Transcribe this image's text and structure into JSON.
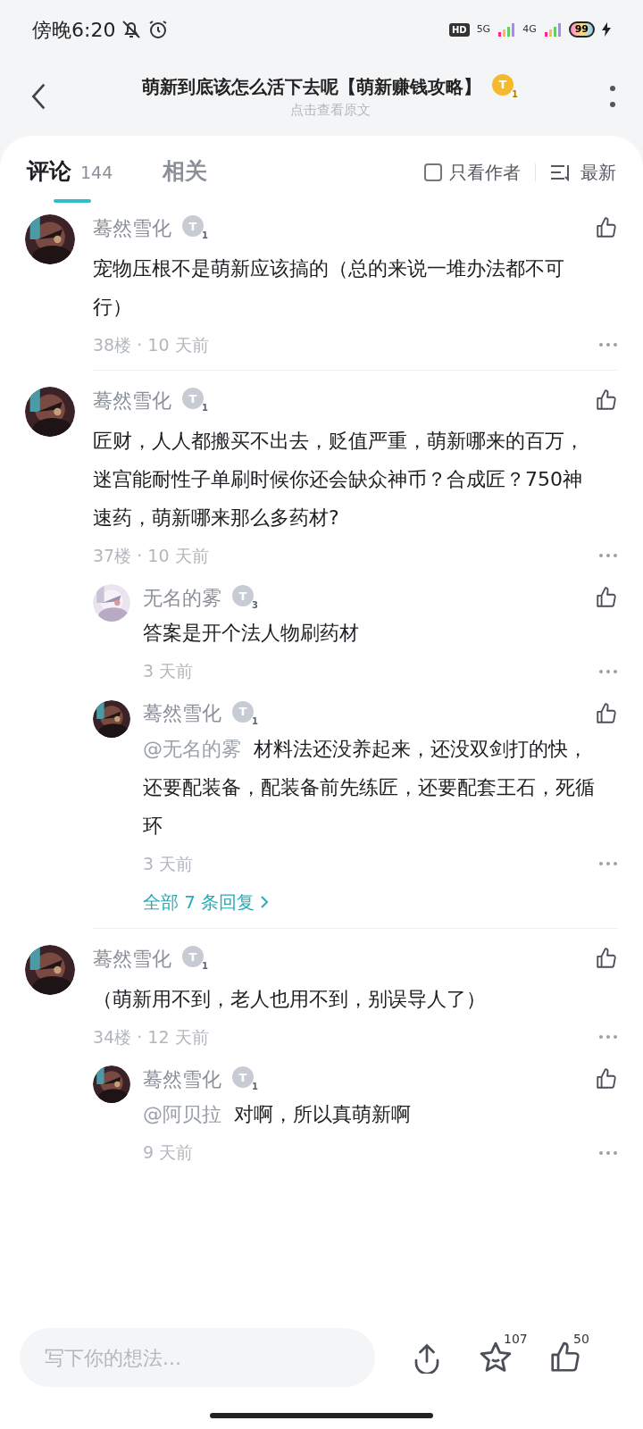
{
  "status_bar": {
    "time": "傍晚6:20",
    "hd": "HD",
    "net1": "5G",
    "net2": "4G",
    "battery": "99"
  },
  "header": {
    "title": "萌新到底该怎么活下去呢【萌新赚钱攻略】",
    "badge": {
      "letter": "T",
      "sub": "1"
    },
    "subtitle": "点击查看原文"
  },
  "tabs": [
    {
      "label": "评论",
      "count": "144",
      "selected": true
    },
    {
      "label": "相关",
      "selected": false
    }
  ],
  "author_only": {
    "label": "只看作者",
    "checked": false
  },
  "sort": {
    "label": "最新"
  },
  "comments": [
    {
      "name": "蓦然雪化",
      "badge": {
        "letter": "T",
        "sub": "1"
      },
      "text": "宠物压根不是萌新应该搞的（总的来说一堆办法都不可行）",
      "meta": "38楼 · 10 天前"
    },
    {
      "name": "蓦然雪化",
      "badge": {
        "letter": "T",
        "sub": "1"
      },
      "text": "匠财，人人都搬买不出去，贬值严重，萌新哪来的百万，迷宫能耐性子单刷时候你还会缺众神币？合成匠？750神速药，萌新哪来那么多药材?",
      "meta": "37楼 · 10 天前",
      "replies": [
        {
          "name": "无名的雾",
          "badge": {
            "letter": "T",
            "sub": "3"
          },
          "text": "答案是开个法人物刷药材",
          "meta": "3 天前"
        },
        {
          "name": "蓦然雪化",
          "badge": {
            "letter": "T",
            "sub": "1"
          },
          "mention": "@无名的雾",
          "text": "材料法还没养起来，还没双剑打的快，还要配装备，配装备前先练匠，还要配套王石，死循环",
          "meta": "3 天前"
        }
      ],
      "more_replies": "全部 7 条回复"
    },
    {
      "name": "蓦然雪化",
      "badge": {
        "letter": "T",
        "sub": "1"
      },
      "text": "（萌新用不到，老人也用不到，别误导人了）",
      "meta": "34楼 · 12 天前",
      "replies": [
        {
          "name": "蓦然雪化",
          "badge": {
            "letter": "T",
            "sub": "1"
          },
          "mention": "@阿贝拉",
          "text": "对啊，所以真萌新啊",
          "meta": "9 天前"
        }
      ]
    }
  ],
  "composer": {
    "placeholder": "写下你的想法..."
  },
  "actions": [
    {
      "kind": "share"
    },
    {
      "kind": "star",
      "count": "107"
    },
    {
      "kind": "like",
      "count": "50"
    }
  ]
}
